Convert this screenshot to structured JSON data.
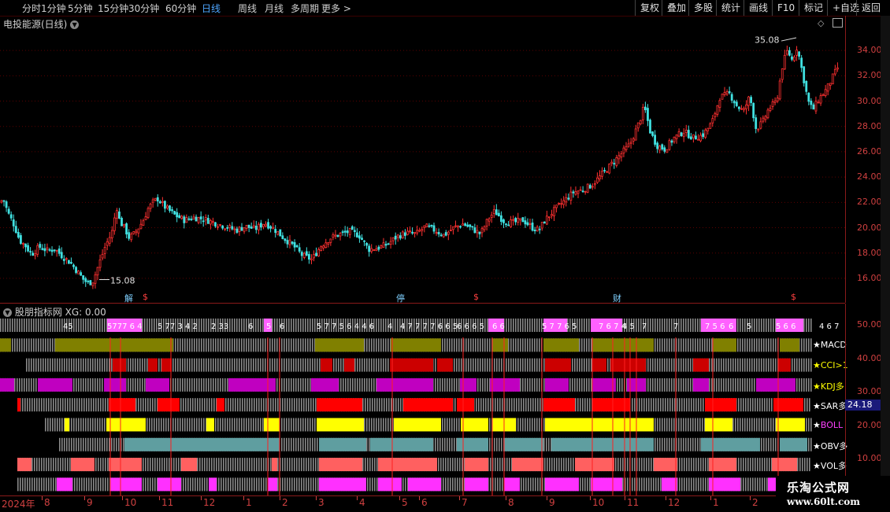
{
  "toolbar": {
    "periods": [
      "分时",
      "1分钟",
      "5分钟",
      "15分钟",
      "30分钟",
      "60分钟",
      "日线",
      "周线",
      "月线",
      "多周期",
      "更多 >"
    ],
    "active": "日线",
    "right_buttons": [
      "复权",
      "叠加",
      "多股",
      "统计",
      "画线",
      "F10",
      "标记",
      "+自选",
      "返回"
    ]
  },
  "stock": {
    "title": "电投能源(日线)"
  },
  "chart_data": {
    "type": "candlestick",
    "price_axis": {
      "ticks": [
        "34.00",
        "32.00",
        "30.00",
        "28.00",
        "26.00",
        "24.00",
        "22.00",
        "20.00",
        "18.00",
        "16.00"
      ],
      "ylim": [
        15,
        35.5
      ]
    },
    "annotations": {
      "high": "35.08",
      "low": "15.08"
    },
    "close_path": [
      [
        0,
        22.0
      ],
      [
        4,
        22.3
      ],
      [
        10,
        21.2
      ],
      [
        18,
        20.2
      ],
      [
        25,
        19.0
      ],
      [
        32,
        18.6
      ],
      [
        40,
        17.9
      ],
      [
        50,
        18.5
      ],
      [
        60,
        18.2
      ],
      [
        70,
        18.3
      ],
      [
        80,
        17.7
      ],
      [
        90,
        17.2
      ],
      [
        100,
        16.4
      ],
      [
        106,
        15.9
      ],
      [
        112,
        15.6
      ],
      [
        118,
        15.8
      ],
      [
        126,
        17.2
      ],
      [
        134,
        18.6
      ],
      [
        142,
        19.6
      ],
      [
        148,
        21.7
      ],
      [
        152,
        20.5
      ],
      [
        158,
        20.0
      ],
      [
        164,
        19.2
      ],
      [
        170,
        19.5
      ],
      [
        176,
        20.0
      ],
      [
        182,
        20.6
      ],
      [
        188,
        21.5
      ],
      [
        194,
        22.0
      ],
      [
        200,
        22.3
      ],
      [
        210,
        21.6
      ],
      [
        222,
        21.0
      ],
      [
        234,
        20.6
      ],
      [
        246,
        20.8
      ],
      [
        258,
        20.7
      ],
      [
        272,
        20.4
      ],
      [
        286,
        20.1
      ],
      [
        300,
        19.8
      ],
      [
        312,
        20.1
      ],
      [
        324,
        19.9
      ],
      [
        336,
        20.4
      ],
      [
        348,
        19.9
      ],
      [
        360,
        19.2
      ],
      [
        372,
        18.6
      ],
      [
        384,
        17.8
      ],
      [
        396,
        17.5
      ],
      [
        408,
        18.6
      ],
      [
        420,
        19.2
      ],
      [
        432,
        19.5
      ],
      [
        444,
        19.7
      ],
      [
        456,
        19.4
      ],
      [
        468,
        18.3
      ],
      [
        480,
        18.4
      ],
      [
        492,
        18.7
      ],
      [
        504,
        19.3
      ],
      [
        516,
        19.6
      ],
      [
        528,
        19.5
      ],
      [
        540,
        20.1
      ],
      [
        552,
        19.8
      ],
      [
        564,
        19.4
      ],
      [
        576,
        20.0
      ],
      [
        588,
        20.3
      ],
      [
        600,
        19.9
      ],
      [
        610,
        19.5
      ],
      [
        620,
        20.7
      ],
      [
        628,
        21.3
      ],
      [
        640,
        20.5
      ],
      [
        652,
        20.4
      ],
      [
        664,
        20.6
      ],
      [
        676,
        20.0
      ],
      [
        684,
        19.8
      ],
      [
        692,
        20.6
      ],
      [
        704,
        21.4
      ],
      [
        716,
        22.1
      ],
      [
        728,
        22.8
      ],
      [
        740,
        23.0
      ],
      [
        752,
        23.4
      ],
      [
        764,
        24.2
      ],
      [
        776,
        25.0
      ],
      [
        788,
        25.8
      ],
      [
        800,
        26.6
      ],
      [
        812,
        28.4
      ],
      [
        818,
        29.6
      ],
      [
        826,
        27.5
      ],
      [
        834,
        26.5
      ],
      [
        844,
        26.2
      ],
      [
        856,
        27.1
      ],
      [
        868,
        27.6
      ],
      [
        880,
        27.1
      ],
      [
        892,
        27.3
      ],
      [
        904,
        28.3
      ],
      [
        914,
        30.3
      ],
      [
        926,
        30.6
      ],
      [
        936,
        29.6
      ],
      [
        944,
        29.2
      ],
      [
        952,
        30.4
      ],
      [
        960,
        27.8
      ],
      [
        968,
        28.3
      ],
      [
        976,
        29.4
      ],
      [
        986,
        30.0
      ],
      [
        994,
        33.0
      ],
      [
        1000,
        34.0
      ],
      [
        1006,
        33.2
      ],
      [
        1012,
        34.3
      ],
      [
        1018,
        32.5
      ],
      [
        1026,
        30.0
      ],
      [
        1032,
        29.3
      ],
      [
        1040,
        30.2
      ],
      [
        1050,
        31.0
      ],
      [
        1058,
        32.0
      ],
      [
        1064,
        32.7
      ]
    ],
    "events": [
      {
        "label": "解",
        "x": 158,
        "color": "#7fd0ff"
      },
      {
        "label": "$",
        "x": 181,
        "color": "#ff4040"
      },
      {
        "label": "停",
        "x": 503,
        "color": "#7fd0ff"
      },
      {
        "label": "$",
        "x": 601,
        "color": "#ff4040"
      },
      {
        "label": "财",
        "x": 778,
        "color": "#7fd0ff"
      },
      {
        "label": "$",
        "x": 1004,
        "color": "#ff4040"
      }
    ],
    "indicator_axis": {
      "ticks": [
        "50.00",
        "40.00",
        "30.00",
        "20.00",
        "10.00"
      ]
    },
    "indicator_rows": [
      {
        "name": "",
        "color": "#ff60ff",
        "start": 0,
        "segments": [
          [
            136,
            150
          ],
          [
            150,
            180
          ],
          [
            335,
            345
          ],
          [
            620,
            640
          ],
          [
            690,
            720
          ],
          [
            750,
            790
          ],
          [
            890,
            935
          ],
          [
            985,
            1020
          ]
        ]
      },
      {
        "name": "★MACD",
        "color": "#808000",
        "start": 0,
        "segments": [
          [
            0,
            14
          ],
          [
            70,
            220
          ],
          [
            400,
            462
          ],
          [
            496,
            560
          ],
          [
            625,
            645
          ],
          [
            690,
            735
          ],
          [
            752,
            830
          ],
          [
            905,
            935
          ],
          [
            990,
            1015
          ]
        ]
      },
      {
        "name": "★CCI>1",
        "color": "#cc0000",
        "start": 33,
        "segments": [
          [
            143,
            160
          ],
          [
            188,
            200
          ],
          [
            205,
            218
          ],
          [
            407,
            422
          ],
          [
            437,
            450
          ],
          [
            495,
            550
          ],
          [
            555,
            575
          ],
          [
            692,
            725
          ],
          [
            752,
            770
          ],
          [
            775,
            820
          ],
          [
            880,
            900
          ],
          [
            988,
            1004
          ]
        ]
      },
      {
        "name": "★KDJ多",
        "color": "#c000c0",
        "start": 0,
        "segments": [
          [
            0,
            18
          ],
          [
            48,
            92
          ],
          [
            132,
            160
          ],
          [
            185,
            215
          ],
          [
            290,
            350
          ],
          [
            395,
            430
          ],
          [
            478,
            550
          ],
          [
            584,
            605
          ],
          [
            622,
            660
          ],
          [
            692,
            722
          ],
          [
            752,
            782
          ],
          [
            796,
            820
          ],
          [
            880,
            900
          ],
          [
            960,
            1010
          ]
        ]
      },
      {
        "name": "★SAR多",
        "color": "#ff0000",
        "start": 22,
        "segments": [
          [
            22,
            26
          ],
          [
            138,
            172
          ],
          [
            200,
            228
          ],
          [
            275,
            285
          ],
          [
            402,
            460
          ],
          [
            512,
            575
          ],
          [
            580,
            602
          ],
          [
            690,
            730
          ],
          [
            752,
            800
          ],
          [
            895,
            935
          ],
          [
            982,
            1020
          ]
        ]
      },
      {
        "name": "★BOLL",
        "color": "#ffff00",
        "start": 57,
        "segments": [
          [
            82,
            88
          ],
          [
            135,
            150
          ],
          [
            150,
            185
          ],
          [
            262,
            272
          ],
          [
            335,
            355
          ],
          [
            402,
            462
          ],
          [
            500,
            560
          ],
          [
            585,
            620
          ],
          [
            625,
            655
          ],
          [
            692,
            830
          ],
          [
            895,
            930
          ],
          [
            985,
            1022
          ]
        ]
      },
      {
        "name": "★OBV多",
        "color": "#5f9ea0",
        "start": 75,
        "segments": [
          [
            158,
            355
          ],
          [
            405,
            465
          ],
          [
            470,
            550
          ],
          [
            580,
            620
          ],
          [
            640,
            690
          ],
          [
            700,
            830
          ],
          [
            890,
            965
          ],
          [
            990,
            1025
          ]
        ]
      },
      {
        "name": "★VOL多",
        "color": "#ff6060",
        "start": 22,
        "segments": [
          [
            22,
            40
          ],
          [
            90,
            120
          ],
          [
            138,
            180
          ],
          [
            230,
            250
          ],
          [
            345,
            352
          ],
          [
            405,
            460
          ],
          [
            480,
            555
          ],
          [
            590,
            620
          ],
          [
            650,
            690
          ],
          [
            730,
            780
          ],
          [
            830,
            860
          ],
          [
            900,
            935
          ],
          [
            980,
            1012
          ]
        ]
      },
      {
        "name": "",
        "color": "#ff30ff",
        "start": 22,
        "segments": [
          [
            72,
            92
          ],
          [
            140,
            180
          ],
          [
            200,
            230
          ],
          [
            265,
            275
          ],
          [
            340,
            352
          ],
          [
            405,
            465
          ],
          [
            480,
            510
          ],
          [
            518,
            560
          ],
          [
            590,
            620
          ],
          [
            640,
            660
          ],
          [
            692,
            735
          ],
          [
            750,
            790
          ],
          [
            840,
            860
          ],
          [
            900,
            940
          ],
          [
            975,
            985
          ]
        ]
      }
    ],
    "top_row_numbers": [
      {
        "x": 80,
        "t": "45"
      },
      {
        "x": 136,
        "t": "5777 6 4"
      },
      {
        "x": 200,
        "t": "5 77 3 4 2"
      },
      {
        "x": 268,
        "t": "2 33"
      },
      {
        "x": 315,
        "t": "6"
      },
      {
        "x": 338,
        "t": "5"
      },
      {
        "x": 355,
        "t": "6"
      },
      {
        "x": 402,
        "t": "5 7 7 5 6 4 4 6"
      },
      {
        "x": 492,
        "t": "4"
      },
      {
        "x": 508,
        "t": "4 7 7 7 7 6 6 5"
      },
      {
        "x": 580,
        "t": "6 6 6 5"
      },
      {
        "x": 625,
        "t": "6 6"
      },
      {
        "x": 688,
        "t": "5 7 7 6 5"
      },
      {
        "x": 760,
        "t": "7 6 7 4"
      },
      {
        "x": 790,
        "t": "4 5"
      },
      {
        "x": 815,
        "t": "7"
      },
      {
        "x": 855,
        "t": "7"
      },
      {
        "x": 895,
        "t": "7 5 6"
      },
      {
        "x": 925,
        "t": "6"
      },
      {
        "x": 948,
        "t": "5"
      },
      {
        "x": 985,
        "t": "5 6 6"
      },
      {
        "x": 1040,
        "t": "4 6 7"
      }
    ],
    "vertical_signals": [
      140,
      153,
      217,
      340,
      355,
      498,
      588,
      625,
      640,
      688,
      752,
      778,
      793,
      800,
      808,
      858,
      905,
      988
    ]
  },
  "date_axis": {
    "labels": [
      {
        "x": 2,
        "t": "2024年"
      },
      {
        "x": 56,
        "t": "8"
      },
      {
        "x": 110,
        "t": "9"
      },
      {
        "x": 158,
        "t": "10"
      },
      {
        "x": 205,
        "t": "11"
      },
      {
        "x": 258,
        "t": "12"
      },
      {
        "x": 312,
        "t": "1"
      },
      {
        "x": 358,
        "t": "2"
      },
      {
        "x": 404,
        "t": "3"
      },
      {
        "x": 456,
        "t": "4"
      },
      {
        "x": 510,
        "t": "5"
      },
      {
        "x": 535,
        "t": "6"
      },
      {
        "x": 586,
        "t": "7"
      },
      {
        "x": 645,
        "t": "8"
      },
      {
        "x": 697,
        "t": "9"
      },
      {
        "x": 752,
        "t": "10"
      },
      {
        "x": 796,
        "t": "11"
      },
      {
        "x": 848,
        "t": "12"
      },
      {
        "x": 905,
        "t": "1"
      },
      {
        "x": 955,
        "t": "2"
      }
    ]
  },
  "indicator": {
    "title": "股朋指标网 XG: 0.00",
    "sar_value": "24.18"
  },
  "watermark": {
    "line1": "乐淘公式网",
    "line2": "www.60lt.com"
  },
  "colors": {
    "up": "#ff3030",
    "down": "#40e0e0",
    "grid": "#5a0000",
    "inactive": "#8a8a8a"
  }
}
